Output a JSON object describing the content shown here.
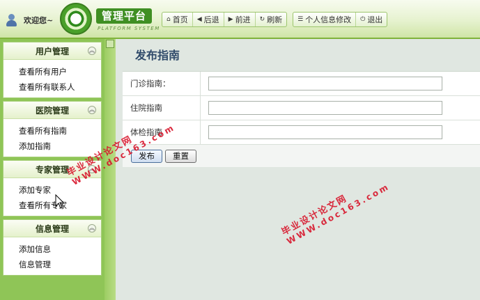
{
  "header": {
    "welcome": "欢迎您~",
    "logo_title": "管理平台",
    "logo_subtitle": "PLATFORM SYSTEM",
    "toolbar": [
      {
        "label": "首页",
        "icon": "home-icon"
      },
      {
        "label": "后退",
        "icon": "back-icon"
      },
      {
        "label": "前进",
        "icon": "forward-icon"
      },
      {
        "label": "刷新",
        "icon": "refresh-icon"
      }
    ],
    "profile_label": "个人信息修改",
    "logout_label": "退出"
  },
  "sidebar": {
    "panels": [
      {
        "title": "用户管理",
        "items": [
          "查看所有用户",
          "查看所有联系人"
        ]
      },
      {
        "title": "医院管理",
        "items": [
          "查看所有指南",
          "添加指南"
        ]
      },
      {
        "title": "专家管理",
        "items": [
          "添加专家",
          "查看所有专家"
        ]
      },
      {
        "title": "信息管理",
        "items": [
          "添加信息",
          "信息管理"
        ]
      }
    ]
  },
  "main": {
    "title": "发布指南",
    "fields": [
      {
        "label": "门诊指南：",
        "value": ""
      },
      {
        "label": "住院指南",
        "value": ""
      },
      {
        "label": "体检指南",
        "value": ""
      }
    ],
    "submit_label": "发布",
    "reset_label": "重置"
  },
  "watermark": {
    "line1": "毕业设计论文网",
    "line2": "WWW.doc163.com"
  }
}
